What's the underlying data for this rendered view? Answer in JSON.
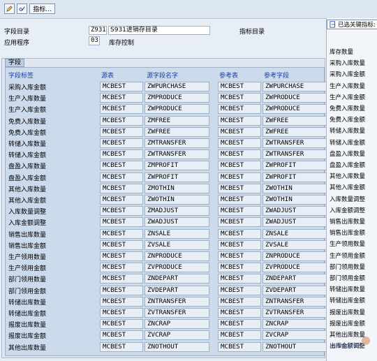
{
  "toolbar": {
    "indicator_button": "指标..."
  },
  "header": {
    "field_catalog_label": "字段目录",
    "field_catalog_code": "Z931",
    "field_catalog_name": "S931进销存目录",
    "indicator_catalog_label": "指标目录",
    "application_label": "应用程序",
    "application_code": "03",
    "application_name": "库存控制"
  },
  "tab": {
    "label": "字段"
  },
  "columns": {
    "field_label": "字段标签",
    "source_table": "源表",
    "source_field": "源字段名字",
    "ref_table": "参考表",
    "ref_field": "参考字段"
  },
  "rows": [
    {
      "label": "采购入库金额",
      "src_table": "MCBEST",
      "src_field": "ZWPURCHASE",
      "ref_table": "MCBEST",
      "ref_field": "ZWPURCHASE"
    },
    {
      "label": "生产入库数量",
      "src_table": "MCBEST",
      "src_field": "ZMPRODUCE",
      "ref_table": "MCBEST",
      "ref_field": "ZWPRODUCE"
    },
    {
      "label": "生产入库金额",
      "src_table": "MCBEST",
      "src_field": "ZWPRODUCE",
      "ref_table": "MCBEST",
      "ref_field": "ZWPRODUCE"
    },
    {
      "label": "免费入库数量",
      "src_table": "MCBEST",
      "src_field": "ZMFREE",
      "ref_table": "MCBEST",
      "ref_field": "ZWFREE"
    },
    {
      "label": "免费入库金额",
      "src_table": "MCBEST",
      "src_field": "ZWFREE",
      "ref_table": "MCBEST",
      "ref_field": "ZWFREE"
    },
    {
      "label": "转储入库数量",
      "src_table": "MCBEST",
      "src_field": "ZMTRANSFER",
      "ref_table": "MCBEST",
      "ref_field": "ZWTRANSFER"
    },
    {
      "label": "转储入库金额",
      "src_table": "MCBEST",
      "src_field": "ZWTRANSFER",
      "ref_table": "MCBEST",
      "ref_field": "ZWTRANSFER"
    },
    {
      "label": "盘盈入库数量",
      "src_table": "MCBEST",
      "src_field": "ZMPROFIT",
      "ref_table": "MCBEST",
      "ref_field": "ZWPROFIT"
    },
    {
      "label": "盘盈入库金额",
      "src_table": "MCBEST",
      "src_field": "ZWPROFIT",
      "ref_table": "MCBEST",
      "ref_field": "ZWPROFIT"
    },
    {
      "label": "其他入库数量",
      "src_table": "MCBEST",
      "src_field": "ZMOTHIN",
      "ref_table": "MCBEST",
      "ref_field": "ZWOTHIN"
    },
    {
      "label": "其他入库金额",
      "src_table": "MCBEST",
      "src_field": "ZWOTHIN",
      "ref_table": "MCBEST",
      "ref_field": "ZWOTHIN"
    },
    {
      "label": "入库数量调整",
      "src_table": "MCBEST",
      "src_field": "ZMADJUST",
      "ref_table": "MCBEST",
      "ref_field": "ZWADJUST"
    },
    {
      "label": "入库金额调整",
      "src_table": "MCBEST",
      "src_field": "ZWADJUST",
      "ref_table": "MCBEST",
      "ref_field": "ZWADJUST"
    },
    {
      "label": "销售出库数量",
      "src_table": "MCBEST",
      "src_field": "ZNSALE",
      "ref_table": "MCBEST",
      "ref_field": "ZNSALE"
    },
    {
      "label": "销售出库金额",
      "src_table": "MCBEST",
      "src_field": "ZVSALE",
      "ref_table": "MCBEST",
      "ref_field": "ZVSALE"
    },
    {
      "label": "生产领用数量",
      "src_table": "MCBEST",
      "src_field": "ZNPRODUCE",
      "ref_table": "MCBEST",
      "ref_field": "ZNPRODUCE"
    },
    {
      "label": "生产领用金额",
      "src_table": "MCBEST",
      "src_field": "ZVPRODUCE",
      "ref_table": "MCBEST",
      "ref_field": "ZVPRODUCE"
    },
    {
      "label": "部门领用数量",
      "src_table": "MCBEST",
      "src_field": "ZNDEPART",
      "ref_table": "MCBEST",
      "ref_field": "ZNDEPART"
    },
    {
      "label": "部门领用金额",
      "src_table": "MCBEST",
      "src_field": "ZVDEPART",
      "ref_table": "MCBEST",
      "ref_field": "ZVDEPART"
    },
    {
      "label": "转储出库数量",
      "src_table": "MCBEST",
      "src_field": "ZNTRANSFER",
      "ref_table": "MCBEST",
      "ref_field": "ZNTRANSFER"
    },
    {
      "label": "转储出库金额",
      "src_table": "MCBEST",
      "src_field": "ZVTRANSFER",
      "ref_table": "MCBEST",
      "ref_field": "ZVTRANSFER"
    },
    {
      "label": "报废出库数量",
      "src_table": "MCBEST",
      "src_field": "ZNCRAP",
      "ref_table": "MCBEST",
      "ref_field": "ZNCRAP"
    },
    {
      "label": "报废出库金额",
      "src_table": "MCBEST",
      "src_field": "ZVCRAP",
      "ref_table": "MCBEST",
      "ref_field": "ZVCRAP"
    },
    {
      "label": "其他出库数量",
      "src_table": "MCBEST",
      "src_field": "ZNOTHOUT",
      "ref_table": "MCBEST",
      "ref_field": "ZNOTHOUT"
    }
  ],
  "right_panel": {
    "header": "已选关键指标:",
    "items": [
      "库存数量",
      "采购入库数量",
      "采购入库金额",
      "生产入库数量",
      "生产入库金额",
      "免费入库数量",
      "免费入库金额",
      "转储入库数量",
      "转储入库金额",
      "盘盈入库数量",
      "盘盈入库金额",
      "其他入库数量",
      "其他入库金额",
      "入库数量调整",
      "入库金额调整",
      "销售出库数量",
      "销售出库金额",
      "生产领用数量",
      "生产领用金额",
      "部门领用数量",
      "部门领用金额",
      "转储出库数量",
      "转储出库金额",
      "报废出库数量",
      "报废出库金额",
      "其他出库数量",
      "出库金额调整"
    ]
  }
}
